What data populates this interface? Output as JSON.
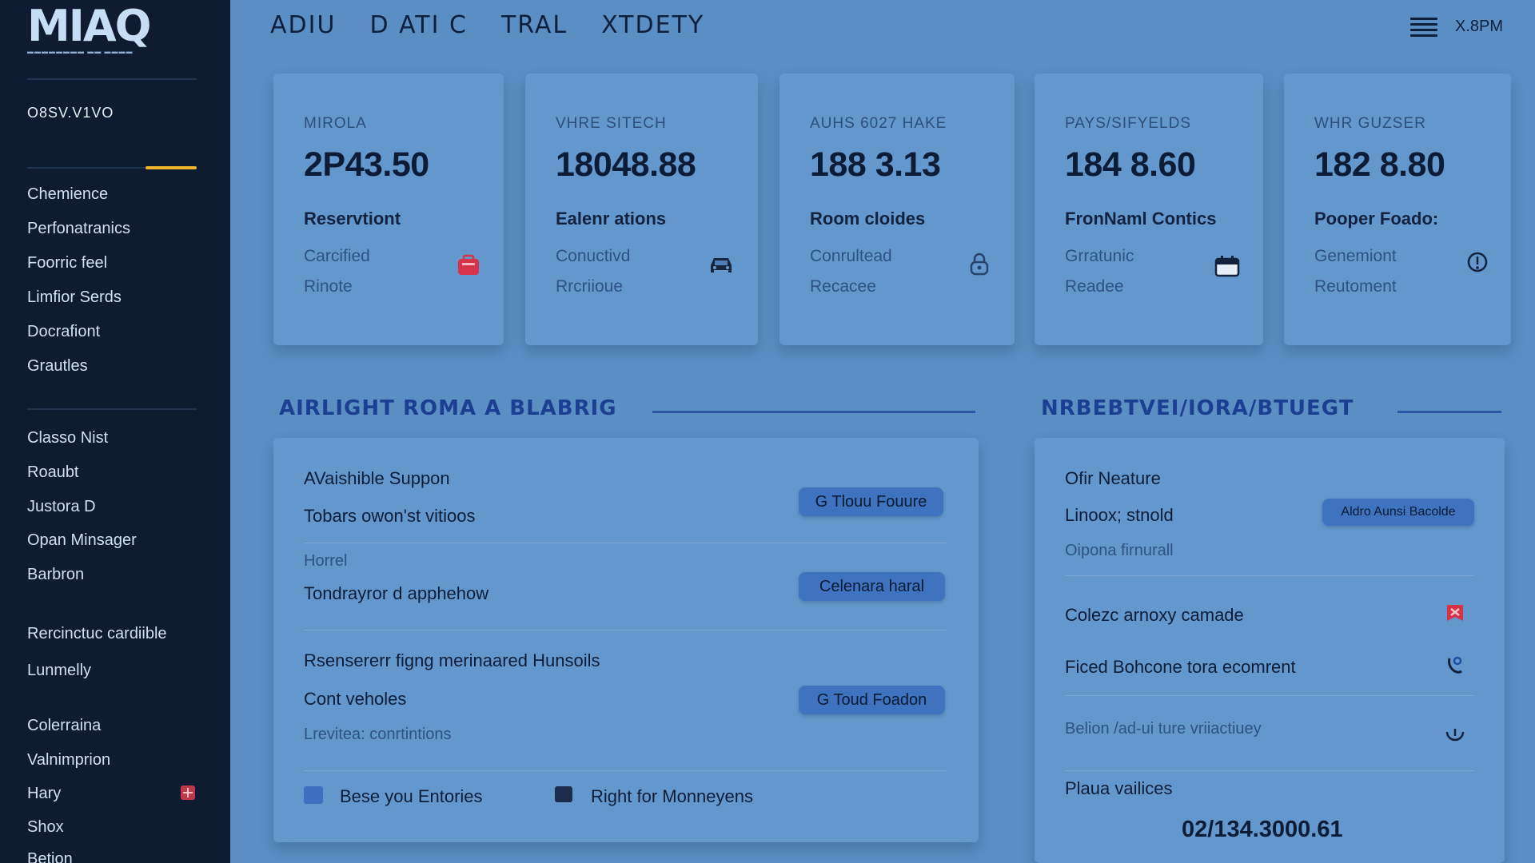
{
  "app": {
    "logo": "MIAQ"
  },
  "sidebar": {
    "heading": "O8SV.V1VO",
    "items": [
      "Chemience",
      "Perfonatranics",
      "Foorric feel",
      "Limfior Serds",
      "Docrafiont",
      "Grautles",
      "Classo Nist",
      "Roaubt",
      "Justora D",
      "Opan Minsager",
      "Barbron",
      "Rercinctuc cardiible",
      "Lunmelly",
      "Colerraina",
      "Valnimprion",
      "Hary",
      "Shox",
      "Betion"
    ]
  },
  "topbar": {
    "nav": [
      "ADIU",
      "D ATI C",
      "TRAL",
      "XTDETY"
    ],
    "time": "X.8PM"
  },
  "cards": [
    {
      "title": "MIROLA",
      "value": "2P43.50",
      "sub": "Reservtiont",
      "line1": "Carcified",
      "line2": "Rinote",
      "icon": "first-aid-icon"
    },
    {
      "title": "VHRE SITECH",
      "value": "18048.88",
      "sub": "Ealenr ations",
      "line1": "Conuctivd",
      "line2": "Rrcriioue",
      "icon": "car-icon"
    },
    {
      "title": "AUHS 6027 HAKE",
      "value": "188 3.13",
      "sub": "Room cloides",
      "line1": "Conrultead",
      "line2": "Recacee",
      "icon": "lock-icon"
    },
    {
      "title": "PAYS/SIFYELDS",
      "value": "184 8.60",
      "sub": "FronNaml Contics",
      "line1": "Grratunic",
      "line2": "Readee",
      "icon": "calendar-icon"
    },
    {
      "title": "WHR GUZSER",
      "value": "182 8.80",
      "sub": "Pooper Foado:",
      "line1": "Genemiont",
      "line2": "Reutoment",
      "icon": "location-pin-icon"
    }
  ],
  "left_section": {
    "title": "AIRLIGHT ROMA A BLABRIG",
    "rows": {
      "r1_title": "AVaishible Suppon",
      "r1_text": "Tobars owon'st vitioos",
      "r1_button": "G Tlouu Fouure",
      "r2_label": "Horrel",
      "r2_text": "Tondrayror d apphehow",
      "r2_button": "Celenara haral",
      "r3_title": "Rsensererr figng merinaared Hunsoils",
      "r3_text": "Cont veholes",
      "r3_muted": "Lrevitea: conrtintions",
      "r3_button": "G Toud Foadon",
      "check1": "Bese you Entories",
      "check2": "Right for Monneyens"
    }
  },
  "right_section": {
    "title": "NRBEBTVEI/IORA/BTUEGT",
    "rows": {
      "r1_title": "Ofir Neature",
      "r1_text": "Linoox; stnold",
      "r1_muted": "Oipona firnurall",
      "r1_button": "Aldro Aunsi Bacolde",
      "r2": "Colezc arnoxy camade",
      "r3": "Ficed Bohcone tora ecomrent",
      "r4": "Belion /ad-ui ture vriiactiuey",
      "r5_label": "Plaua vailices",
      "r5_value": "02/134.3000.61"
    }
  },
  "colors": {
    "background": "#5b8fc4",
    "sidebar": "#0e1b30",
    "accent": "#f0b429",
    "section_title": "#1d3f93",
    "pill": "#3f73c0",
    "alert": "#d6334a"
  }
}
